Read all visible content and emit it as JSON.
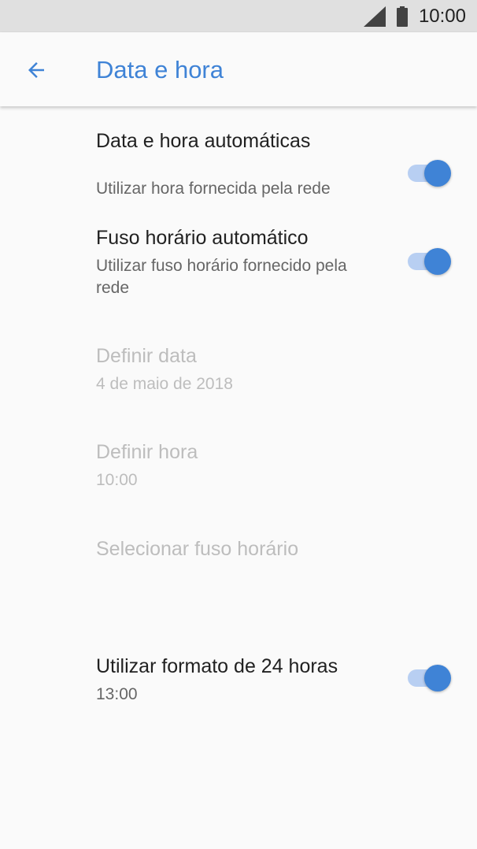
{
  "status_bar": {
    "time": "10:00",
    "icons": [
      "signal-icon",
      "battery-icon"
    ]
  },
  "app_bar": {
    "title": "Data e hora",
    "back_icon": "arrow-back-icon"
  },
  "colors": {
    "accent": "#3f83d6",
    "track": "#b8cff2",
    "status_bar_bg": "#e0e0e0",
    "background": "#fafafa",
    "disabled_text": "#bdbdbd"
  },
  "settings": [
    {
      "title": "Data e hora automáticas",
      "summary": "Utilizar hora fornecida pela rede",
      "toggle": true,
      "enabled": true
    },
    {
      "title": "Fuso horário automático",
      "summary": "Utilizar fuso horário fornecido pela rede",
      "toggle": true,
      "enabled": true
    },
    {
      "title": "Definir data",
      "summary": "4 de maio de 2018",
      "enabled": false
    },
    {
      "title": "Definir hora",
      "summary": "10:00",
      "enabled": false
    },
    {
      "title": "Selecionar fuso horário",
      "summary": "",
      "enabled": false
    },
    {
      "title": "Utilizar formato de 24 horas",
      "summary": "13:00",
      "toggle": true,
      "enabled": true
    }
  ]
}
